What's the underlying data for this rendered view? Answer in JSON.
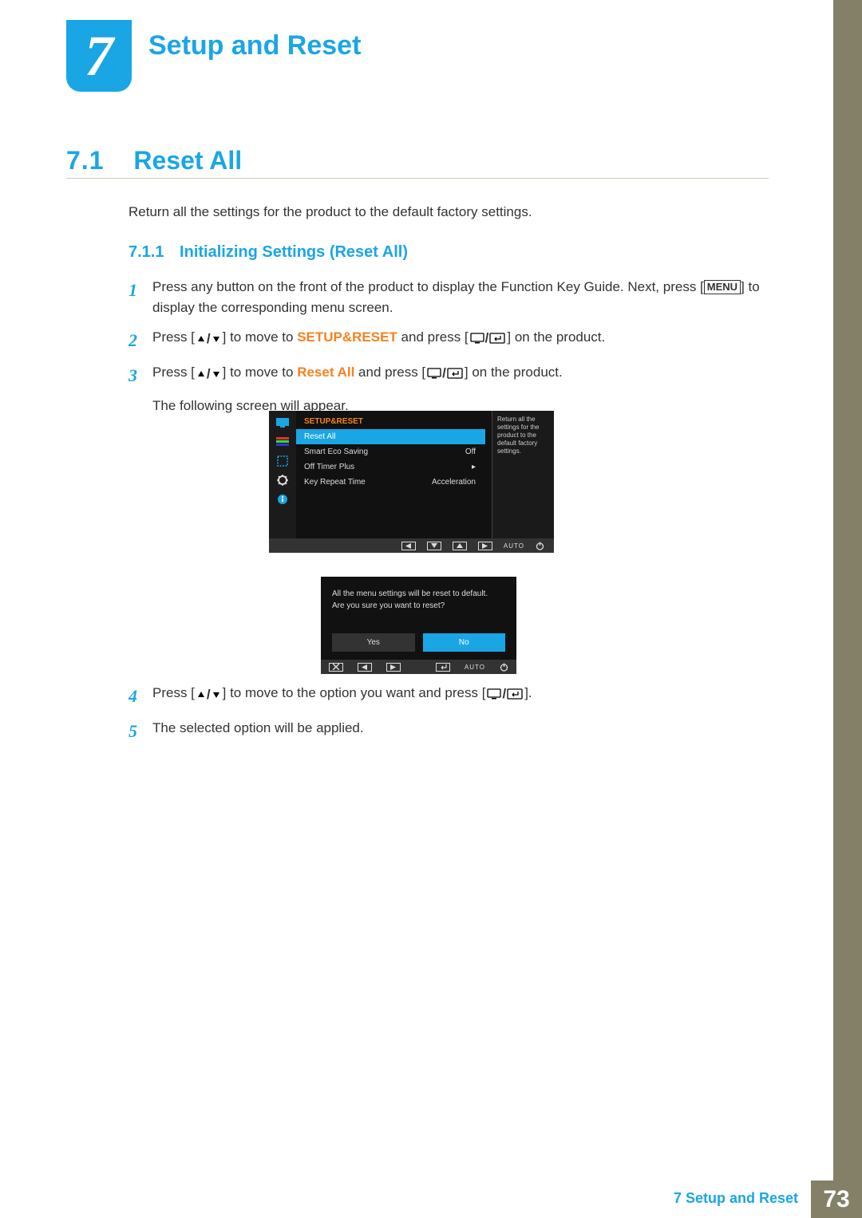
{
  "chapter": {
    "num": "7",
    "title": "Setup and Reset"
  },
  "section": {
    "num": "7.1",
    "title": "Reset All"
  },
  "intro": "Return all the settings for the product to the default factory settings.",
  "sub": {
    "num": "7.1.1",
    "title": "Initializing Settings (Reset All)"
  },
  "step1": {
    "pre": "Press any button on the front of the product to display the Function Key Guide. Next, press [",
    "btn": "MENU",
    "post": "] to display the corresponding menu screen."
  },
  "step2": {
    "pre": "Press [",
    "mid": "] to move to ",
    "hl": "SETUP&RESET",
    "post1": " and press [",
    "post2": "] on the product."
  },
  "step3": {
    "pre": "Press [",
    "mid": "] to move to ",
    "hl": "Reset All",
    "post1": " and press [",
    "post2": "] on the product.",
    "follow": "The following screen will appear."
  },
  "step4": {
    "pre": "Press [",
    "mid": "] to move to the option you want and press [",
    "post": "]."
  },
  "step5": "The selected option will be applied.",
  "osd": {
    "head": "SETUP&RESET",
    "rows": [
      {
        "label": "Reset All",
        "value": ""
      },
      {
        "label": "Smart Eco Saving",
        "value": "Off"
      },
      {
        "label": "Off Timer Plus",
        "value": "▸"
      },
      {
        "label": "Key Repeat Time",
        "value": "Acceleration"
      }
    ],
    "desc": "Return all the settings for the product to the default factory settings.",
    "auto": "AUTO"
  },
  "confirm": {
    "line1": "All the menu settings will be reset to default.",
    "line2": "Are you sure you want to reset?",
    "yes": "Yes",
    "no": "No",
    "auto": "AUTO"
  },
  "footer": {
    "label": "7 Setup and Reset",
    "page": "73"
  }
}
